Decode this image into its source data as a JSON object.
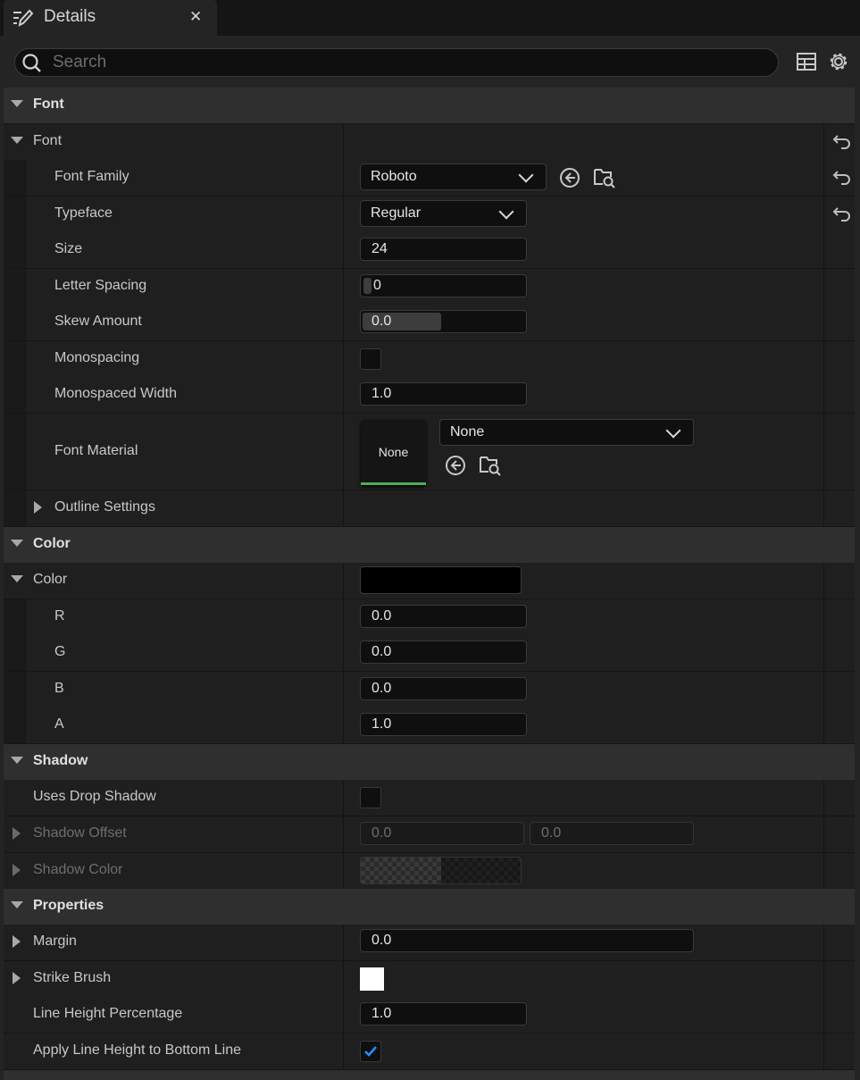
{
  "tab": {
    "title": "Details",
    "close": "✕"
  },
  "search": {
    "placeholder": "Search"
  },
  "sections": {
    "font": "Font",
    "color": "Color",
    "shadow": "Shadow",
    "properties": "Properties"
  },
  "font": {
    "group_label": "Font",
    "family_label": "Font Family",
    "family_value": "Roboto",
    "typeface_label": "Typeface",
    "typeface_value": "Regular",
    "size_label": "Size",
    "size_value": "24",
    "letter_spacing_label": "Letter Spacing",
    "letter_spacing_value": "0",
    "skew_label": "Skew Amount",
    "skew_value": "0.0",
    "monospacing_label": "Monospacing",
    "monospaced_width_label": "Monospaced Width",
    "monospaced_width_value": "1.0",
    "material_label": "Font Material",
    "material_thumb": "None",
    "material_value": "None",
    "outline_label": "Outline Settings"
  },
  "color": {
    "group_label": "Color",
    "swatch": "#000000",
    "r_label": "R",
    "r_value": "0.0",
    "g_label": "G",
    "g_value": "0.0",
    "b_label": "B",
    "b_value": "0.0",
    "a_label": "A",
    "a_value": "1.0"
  },
  "shadow": {
    "uses_drop_label": "Uses Drop Shadow",
    "offset_label": "Shadow Offset",
    "offset_x": "0.0",
    "offset_y": "0.0",
    "color_label": "Shadow Color"
  },
  "properties": {
    "margin_label": "Margin",
    "margin_value": "0.0",
    "strike_label": "Strike Brush",
    "line_height_label": "Line Height Percentage",
    "line_height_value": "1.0",
    "apply_line_height_label": "Apply Line Height to Bottom Line",
    "apply_line_height_checked": true
  },
  "colors": {
    "accent_blue": "#1f8fff",
    "material_green": "#4caf50"
  }
}
